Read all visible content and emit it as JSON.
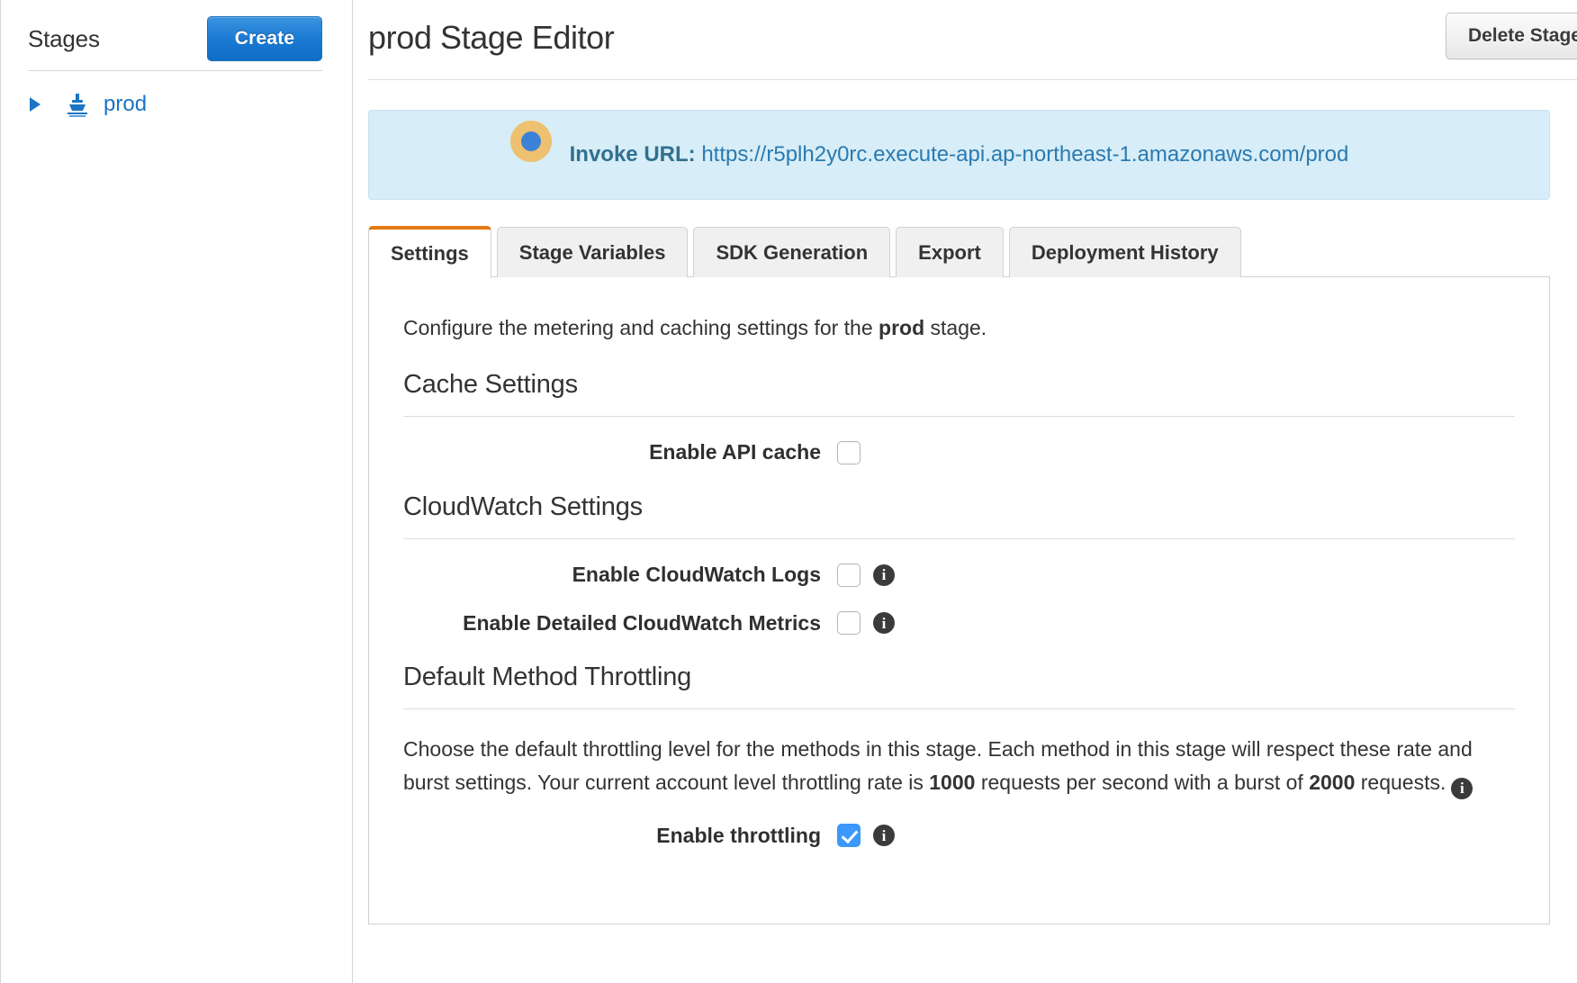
{
  "sidebar": {
    "title": "Stages",
    "create_label": "Create",
    "stage": {
      "name": "prod",
      "disclosure_icon": "triangle-right-icon",
      "stage_icon": "stage-ship-icon"
    }
  },
  "header": {
    "title": "prod Stage Editor",
    "delete_label": "Delete Stage"
  },
  "banner": {
    "label": "Invoke URL:",
    "url": "https://r5plh2y0rc.execute-api.ap-northeast-1.amazonaws.com/prod",
    "cursor_icon": "pointer-dot-icon"
  },
  "tabs": [
    {
      "label": "Settings",
      "active": true
    },
    {
      "label": "Stage Variables",
      "active": false
    },
    {
      "label": "SDK Generation",
      "active": false
    },
    {
      "label": "Export",
      "active": false
    },
    {
      "label": "Deployment History",
      "active": false
    }
  ],
  "settings": {
    "intro_prefix": "Configure the metering and caching settings for the ",
    "intro_stage": "prod",
    "intro_suffix": " stage.",
    "cache": {
      "heading": "Cache Settings",
      "enable_label": "Enable API cache",
      "enable_checked": false
    },
    "cloudwatch": {
      "heading": "CloudWatch Settings",
      "logs_label": "Enable CloudWatch Logs",
      "logs_checked": false,
      "metrics_label": "Enable Detailed CloudWatch Metrics",
      "metrics_checked": false
    },
    "throttling": {
      "heading": "Default Method Throttling",
      "desc_part1": "Choose the default throttling level for the methods in this stage. Each method in this stage will respect these rate and burst settings. Your current account level throttling rate is ",
      "rate_value": "1000",
      "desc_part2": " requests per second with a burst of ",
      "burst_value": "2000",
      "desc_part3": " requests.",
      "enable_label": "Enable throttling",
      "enable_checked": true
    }
  },
  "colors": {
    "accent_orange": "#e47911",
    "link_blue": "#1b74c4",
    "banner_bg": "#d7edf7",
    "checkbox_checked": "#3b99fc",
    "create_blue": "#1a7ad4"
  }
}
